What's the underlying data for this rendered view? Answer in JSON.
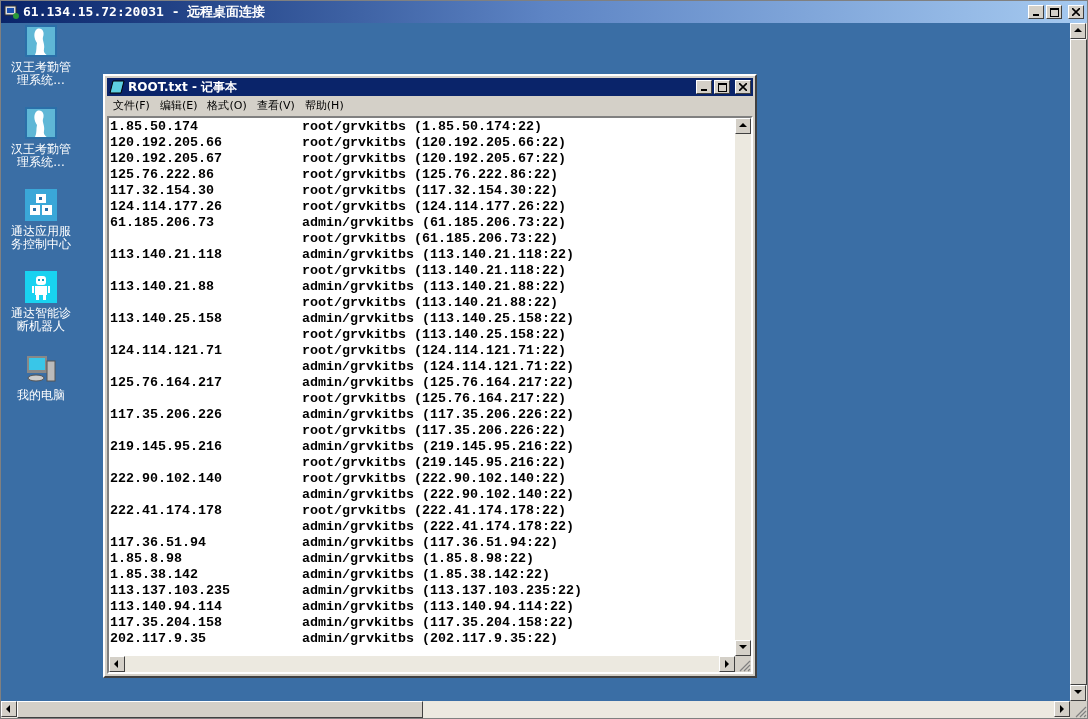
{
  "window": {
    "title": "61.134.15.72:20031 - 远程桌面连接"
  },
  "desktop_icons": [
    {
      "kind": "person",
      "label": "汉王考勤管理系统..."
    },
    {
      "kind": "person",
      "label": "汉王考勤管理系统..."
    },
    {
      "kind": "blocks",
      "label": "通达应用服务控制中心"
    },
    {
      "kind": "robot",
      "label": "通达智能诊断机器人"
    },
    {
      "kind": "computer",
      "label": "我的电脑"
    }
  ],
  "notepad": {
    "title": "ROOT.txt - 记事本",
    "menu": [
      "文件(F)",
      "编辑(E)",
      "格式(O)",
      "查看(V)",
      "帮助(H)"
    ],
    "lines": [
      {
        "ip": "1.85.50.174",
        "credential": "root/grvkitbs (1.85.50.174:22)"
      },
      {
        "ip": "120.192.205.66",
        "credential": "root/grvkitbs (120.192.205.66:22)"
      },
      {
        "ip": "120.192.205.67",
        "credential": "root/grvkitbs (120.192.205.67:22)"
      },
      {
        "ip": "125.76.222.86",
        "credential": "root/grvkitbs (125.76.222.86:22)"
      },
      {
        "ip": "117.32.154.30",
        "credential": "root/grvkitbs (117.32.154.30:22)"
      },
      {
        "ip": "124.114.177.26",
        "credential": "root/grvkitbs (124.114.177.26:22)"
      },
      {
        "ip": "61.185.206.73",
        "credential": "admin/grvkitbs (61.185.206.73:22)"
      },
      {
        "credential": "root/grvkitbs (61.185.206.73:22)"
      },
      {
        "ip": "113.140.21.118",
        "credential": "admin/grvkitbs (113.140.21.118:22)"
      },
      {
        "credential": "root/grvkitbs (113.140.21.118:22)"
      },
      {
        "ip": "113.140.21.88",
        "credential": "admin/grvkitbs (113.140.21.88:22)"
      },
      {
        "credential": "root/grvkitbs (113.140.21.88:22)"
      },
      {
        "ip": "113.140.25.158",
        "credential": "admin/grvkitbs (113.140.25.158:22)"
      },
      {
        "credential": "root/grvkitbs (113.140.25.158:22)"
      },
      {
        "ip": "124.114.121.71",
        "credential": "root/grvkitbs (124.114.121.71:22)"
      },
      {
        "credential": "admin/grvkitbs (124.114.121.71:22)"
      },
      {
        "ip": "125.76.164.217",
        "credential": "admin/grvkitbs (125.76.164.217:22)"
      },
      {
        "credential": "root/grvkitbs (125.76.164.217:22)"
      },
      {
        "ip": "117.35.206.226",
        "credential": "admin/grvkitbs (117.35.206.226:22)"
      },
      {
        "credential": "root/grvkitbs (117.35.206.226:22)"
      },
      {
        "ip": "219.145.95.216",
        "credential": "admin/grvkitbs (219.145.95.216:22)"
      },
      {
        "credential": "root/grvkitbs (219.145.95.216:22)"
      },
      {
        "ip": "222.90.102.140",
        "credential": "root/grvkitbs (222.90.102.140:22)"
      },
      {
        "credential": "admin/grvkitbs (222.90.102.140:22)"
      },
      {
        "ip": "222.41.174.178",
        "credential": "root/grvkitbs (222.41.174.178:22)"
      },
      {
        "credential": "admin/grvkitbs (222.41.174.178:22)"
      },
      {
        "ip": "117.36.51.94",
        "credential": "admin/grvkitbs (117.36.51.94:22)"
      },
      {
        "ip": "1.85.8.98",
        "credential": "admin/grvkitbs (1.85.8.98:22)"
      },
      {
        "ip": "1.85.38.142",
        "credential": "admin/grvkitbs (1.85.38.142:22)"
      },
      {
        "ip": "113.137.103.235",
        "credential": "admin/grvkitbs (113.137.103.235:22)"
      },
      {
        "ip": "113.140.94.114",
        "credential": "admin/grvkitbs (113.140.94.114:22)"
      },
      {
        "ip": "117.35.204.158",
        "credential": "admin/grvkitbs (117.35.204.158:22)"
      },
      {
        "ip": "202.117.9.35",
        "credential": "admin/grvkitbs (202.117.9.35:22)"
      }
    ]
  }
}
